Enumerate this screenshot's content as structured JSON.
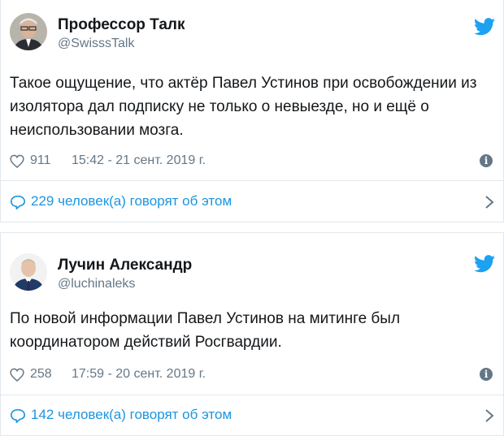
{
  "tweets": [
    {
      "name": "Профессор Талк",
      "handle": "@SwisssTalk",
      "text": "Такое ощущение, что актёр Павел Устинов при освобождении из изолятора дал подписку не только о невыезде, но и ещё о неиспользовании мозга.",
      "likes": "911",
      "time": "15:42 - 21 сент. 2019 г.",
      "discussion": "229 человек(а) говорят об этом",
      "icons": [
        "avatar",
        "twitter-bird-icon",
        "heart-icon",
        "info-icon",
        "comment-bubble-icon",
        "chevron-right-icon"
      ]
    },
    {
      "name": "Лучин Александр",
      "handle": "@luchinaleks",
      "text": "По новой информации Павел Устинов на митинге был координатором действий Росгвардии.",
      "likes": "258",
      "time": "17:59 - 20 сент. 2019 г.",
      "discussion": "142 человек(а) говорят об этом",
      "icons": [
        "avatar",
        "twitter-bird-icon",
        "heart-icon",
        "info-icon",
        "comment-bubble-icon",
        "chevron-right-icon"
      ]
    }
  ],
  "colors": {
    "accent": "#1da1f2",
    "link": "#1b95e0",
    "muted": "#657786",
    "border": "#e1e8ed",
    "text": "#14171a"
  }
}
